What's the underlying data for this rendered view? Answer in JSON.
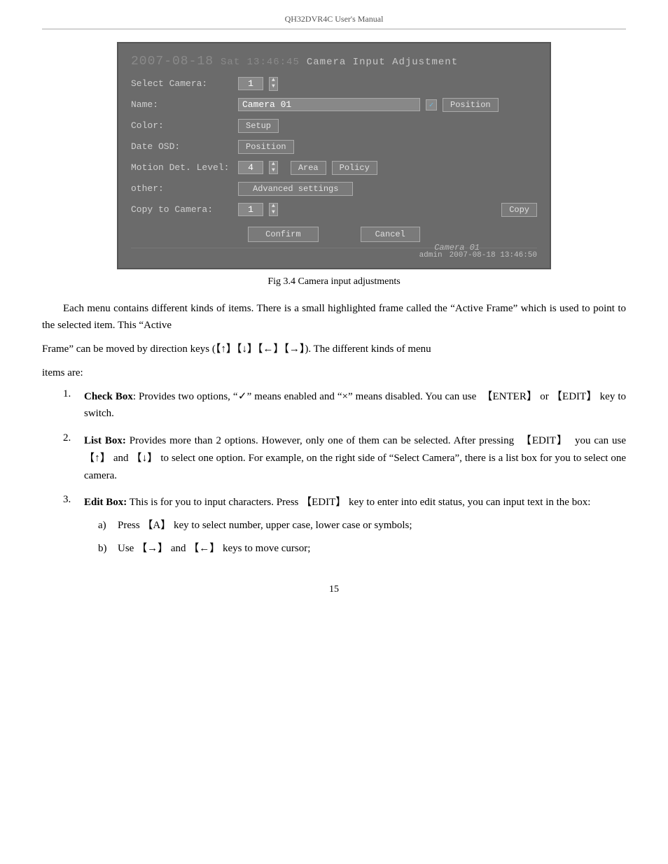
{
  "header": {
    "title": "QH32DVR4C User's Manual"
  },
  "screenshot": {
    "date": "2007-08-18",
    "datetime_overlay": "Sat 13:46:45",
    "title": "Camera Input Adjustment",
    "select_camera_label": "Select Camera:",
    "select_camera_value": "1",
    "name_label": "Name:",
    "name_value": "Camera 01",
    "position_btn": "Position",
    "color_label": "Color:",
    "setup_btn": "Setup",
    "date_osd_label": "Date OSD:",
    "date_osd_btn": "Position",
    "motion_label": "Motion Det. Level:",
    "motion_value": "4",
    "area_btn": "Area",
    "policy_btn": "Policy",
    "other_label": "other:",
    "advanced_btn": "Advanced settings",
    "copy_label": "Copy to Camera:",
    "copy_value": "1",
    "copy_btn": "Copy",
    "confirm_btn": "Confirm",
    "cancel_btn": "Cancel",
    "footer_user": "admin",
    "footer_datetime": "2007-08-18 13:46:50",
    "footer_camera": "Camera 01"
  },
  "caption": "Fig 3.4 Camera input adjustments",
  "paragraphs": {
    "p1": "Each menu contains different kinds of items. There is a small highlighted frame called the “Active Frame” which is used to point to the selected item. This “Active Frame” can be moved by direction keys (【↑】【↓】【←】【→】). The different kinds of menu items are:"
  },
  "list": [
    {
      "num": "1.",
      "bold": "Check Box",
      "text": ": Provides two options, “✓” means enabled and “×” means disabled. You can use 【ENTER】 or 【EDIT】 key to switch."
    },
    {
      "num": "2.",
      "bold": "List Box:",
      "text": " Provides more than 2 options. However, only one of them can be selected. After pressing 【EDIT】 you can use 【↑】 and 【↓】 to select one option. For example, on the right side of “Select Camera”, there is a list box for you to select one camera."
    },
    {
      "num": "3.",
      "bold": "Edit Box:",
      "text": " This is for you to input characters. Press 【EDIT】 key to enter into edit status, you can input text in the box:",
      "sub": [
        {
          "label": "a)",
          "text": "Press 【A】 key to select number, upper case, lower case or symbols;"
        },
        {
          "label": "b)",
          "text": "Use 【→】 and 【←】 keys to move cursor;"
        }
      ]
    }
  ],
  "page_num": "15"
}
